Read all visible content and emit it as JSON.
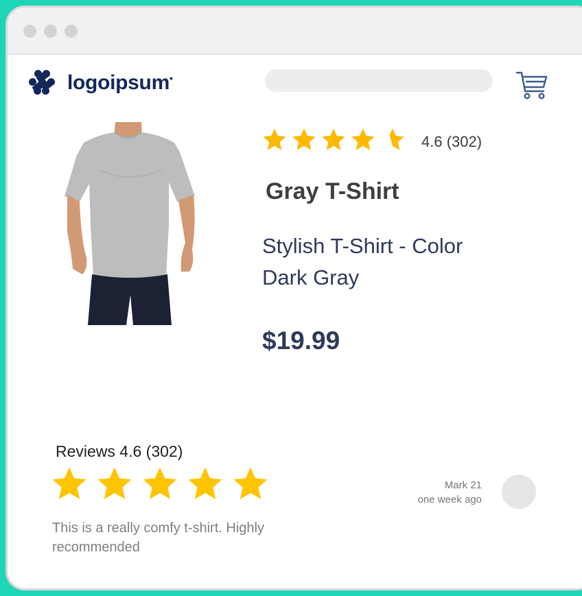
{
  "window": {
    "controls": [
      "close",
      "minimize",
      "maximize"
    ]
  },
  "header": {
    "logo_text": "logoipsum",
    "logo_icon": "logo-mark-icon",
    "search_placeholder": "",
    "cart_icon": "cart-icon"
  },
  "product": {
    "image": "gray-t-shirt-model-photo",
    "rating_value": 4.6,
    "rating_text": "4.6 (302)",
    "title": "Gray T-Shirt",
    "description": "Stylish T-Shirt - Color Dark Gray",
    "price": "$19.99"
  },
  "reviews": {
    "title": "Reviews 4.6 (302)",
    "items": [
      {
        "stars": 5,
        "author": "Mark 21",
        "time": "one week ago",
        "text": "This is a really comfy t-shirt. Highly recommended"
      }
    ]
  },
  "colors": {
    "page_background": "#1ed6b6",
    "star": "#ffb800",
    "brand": "#14275c",
    "text_dark_blue": "#2e3a5a"
  }
}
